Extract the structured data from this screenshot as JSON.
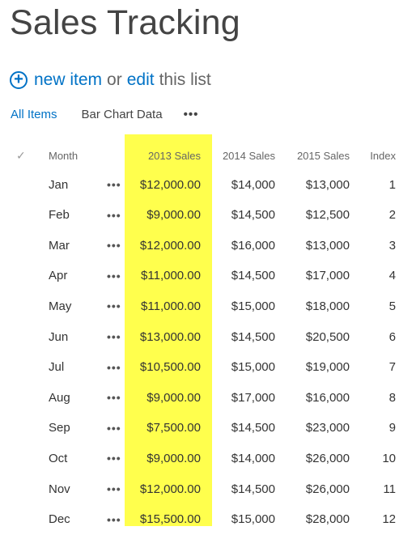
{
  "page": {
    "title": "Sales Tracking"
  },
  "toolbar": {
    "new_item": "new item",
    "or": "or",
    "edit": "edit",
    "this_list": "this list"
  },
  "views": {
    "all_items": "All Items",
    "bar_chart": "Bar Chart Data",
    "more": "•••"
  },
  "columns": {
    "check": "✓",
    "month": "Month",
    "sales_2013": "2013 Sales",
    "sales_2014": "2014 Sales",
    "sales_2015": "2015 Sales",
    "index": "Index"
  },
  "highlight_color": "#ffff4d",
  "accent_color": "#0072c6",
  "rows": [
    {
      "month": "Jan",
      "dots": "•••",
      "s2013": "$12,000.00",
      "s2014": "$14,000",
      "s2015": "$13,000",
      "index": "1"
    },
    {
      "month": "Feb",
      "dots": "•••",
      "s2013": "$9,000.00",
      "s2014": "$14,500",
      "s2015": "$12,500",
      "index": "2"
    },
    {
      "month": "Mar",
      "dots": "•••",
      "s2013": "$12,000.00",
      "s2014": "$16,000",
      "s2015": "$13,000",
      "index": "3"
    },
    {
      "month": "Apr",
      "dots": "•••",
      "s2013": "$11,000.00",
      "s2014": "$14,500",
      "s2015": "$17,000",
      "index": "4"
    },
    {
      "month": "May",
      "dots": "•••",
      "s2013": "$11,000.00",
      "s2014": "$15,000",
      "s2015": "$18,000",
      "index": "5"
    },
    {
      "month": "Jun",
      "dots": "•••",
      "s2013": "$13,000.00",
      "s2014": "$14,500",
      "s2015": "$20,500",
      "index": "6"
    },
    {
      "month": "Jul",
      "dots": "•••",
      "s2013": "$10,500.00",
      "s2014": "$15,000",
      "s2015": "$19,000",
      "index": "7"
    },
    {
      "month": "Aug",
      "dots": "•••",
      "s2013": "$9,000.00",
      "s2014": "$17,000",
      "s2015": "$16,000",
      "index": "8"
    },
    {
      "month": "Sep",
      "dots": "•••",
      "s2013": "$7,500.00",
      "s2014": "$14,500",
      "s2015": "$23,000",
      "index": "9"
    },
    {
      "month": "Oct",
      "dots": "•••",
      "s2013": "$9,000.00",
      "s2014": "$14,000",
      "s2015": "$26,000",
      "index": "10"
    },
    {
      "month": "Nov",
      "dots": "•••",
      "s2013": "$12,000.00",
      "s2014": "$14,500",
      "s2015": "$26,000",
      "index": "11"
    },
    {
      "month": "Dec",
      "dots": "•••",
      "s2013": "$15,500.00",
      "s2014": "$15,000",
      "s2015": "$28,000",
      "index": "12"
    }
  ]
}
